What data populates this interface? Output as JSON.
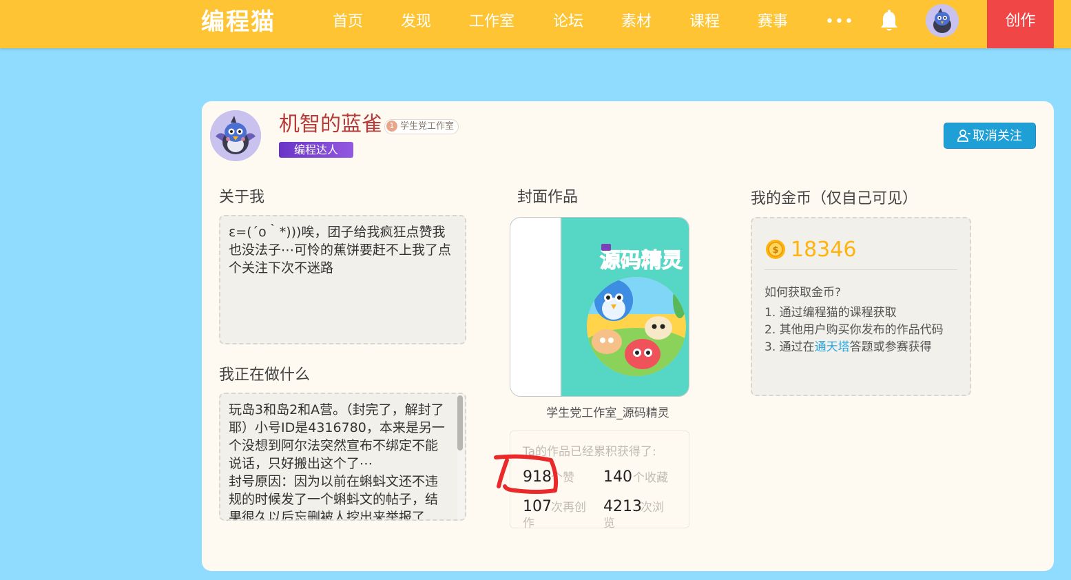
{
  "topbar": {
    "logo": "编程猫",
    "nav": [
      "首页",
      "发现",
      "工作室",
      "论坛",
      "素材",
      "课程",
      "赛事"
    ],
    "more": "•••",
    "create": "创作",
    "colors": {
      "bar": "#fec433",
      "create": "#f04646"
    }
  },
  "profile": {
    "name": "机智的蓝雀",
    "studio_level": "1",
    "studio": "学生党工作室",
    "badge": "编程达人",
    "unfollow": "取消关注"
  },
  "about": {
    "title": "关于我",
    "text": "ε=(´ο｀*)))唉，团子给我疯狂点赞我也没法子⋯可怜的蕉饼要赶不上我了点个关注下次不迷路"
  },
  "doing": {
    "title": "我正在做什么",
    "lines": [
      "玩岛3和岛2和A营。（封完了，解封了耶）小号ID是4316780，本来是另一个没想到阿尔法突然宣布不绑定不能说话，只好搬出这个了⋯",
      "封号原因：因为以前在蝌蚪文还不违规的时候发了一个蝌蚪文的帖子，结果很久以后忘删被人挖出来举报了"
    ]
  },
  "cover": {
    "title": "封面作品",
    "art_text": "源码精灵",
    "caption": "学生党工作室_源码精灵"
  },
  "stats": {
    "head": "Ta的作品已经累积获得了:",
    "likes": "918",
    "likes_unit": "个赞",
    "favorites": "140",
    "favorites_unit": "个收藏",
    "remix": "107",
    "remix_unit_1": "次再创",
    "remix_unit_2": "作",
    "views": "4213",
    "views_unit_1": "次浏",
    "views_unit_2": "览"
  },
  "coins": {
    "title": "我的金币（仅自己可见）",
    "amount": "18346",
    "question": "如何获取金币?",
    "item1": "1. 通过编程猫的课程获取",
    "item2": "2. 其他用户购买你发布的作品代码",
    "item3_pre": "3. 通过在",
    "item3_link": "通天塔",
    "item3_post": "答题或参赛获得"
  }
}
